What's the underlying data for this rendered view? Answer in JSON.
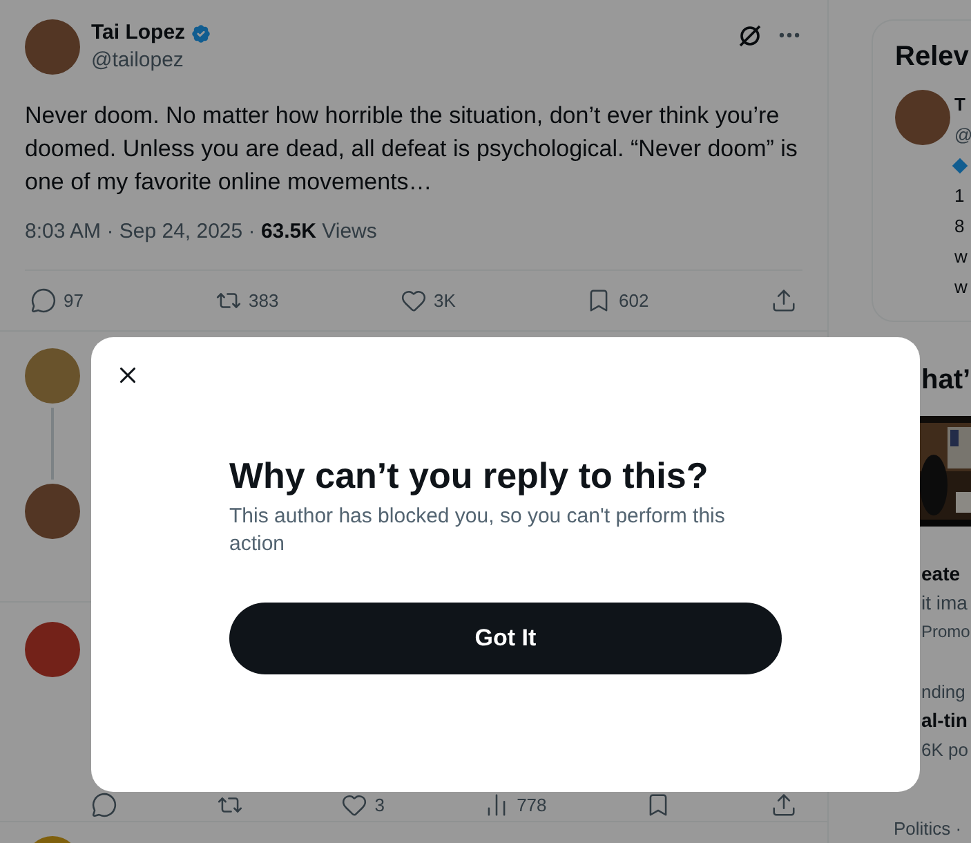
{
  "tweet": {
    "author": {
      "name": "Tai Lopez",
      "handle": "@tailopez",
      "verified": true
    },
    "text": "Never doom. No matter how horrible the situation, don’t ever think you’re doomed. Unless you are dead, all defeat is psychological. “Never doom” is one of my favorite online movements…",
    "meta": "8:03 AM · Sep 24, 2025 · **63.5K** Views",
    "actions": [
      {
        "kind": "reply",
        "count": "97"
      },
      {
        "kind": "repost",
        "count": "383"
      },
      {
        "kind": "like",
        "count": "3K"
      },
      {
        "kind": "bookmark",
        "count": "602"
      },
      {
        "kind": "share"
      }
    ]
  },
  "reply_actions": [
    {
      "kind": "reply"
    },
    {
      "kind": "repost"
    },
    {
      "kind": "like",
      "count": "3"
    },
    {
      "kind": "views",
      "count": "778"
    },
    {
      "kind": "bookmark"
    },
    {
      "kind": "share"
    }
  ],
  "sidebar": {
    "relevant": {
      "title": "Relev",
      "name": "T",
      "handle": "@",
      "bio_lines": [
        "1",
        "8",
        "w",
        "w"
      ]
    },
    "trends": {
      "title": "hat’",
      "items": [
        {
          "kind": "promoted",
          "title": "eate",
          "text": "it ima",
          "label": "Promo"
        },
        {
          "kind": "trend",
          "context": "nding",
          "title": "al-tin",
          "posts": "6K po"
        },
        {
          "kind": "trend",
          "context": "Politics ·"
        }
      ]
    }
  },
  "dialog": {
    "title": "Why can’t you reply to this?",
    "message": "This author has blocked you, so you can't perform this action",
    "button": "Got It"
  }
}
